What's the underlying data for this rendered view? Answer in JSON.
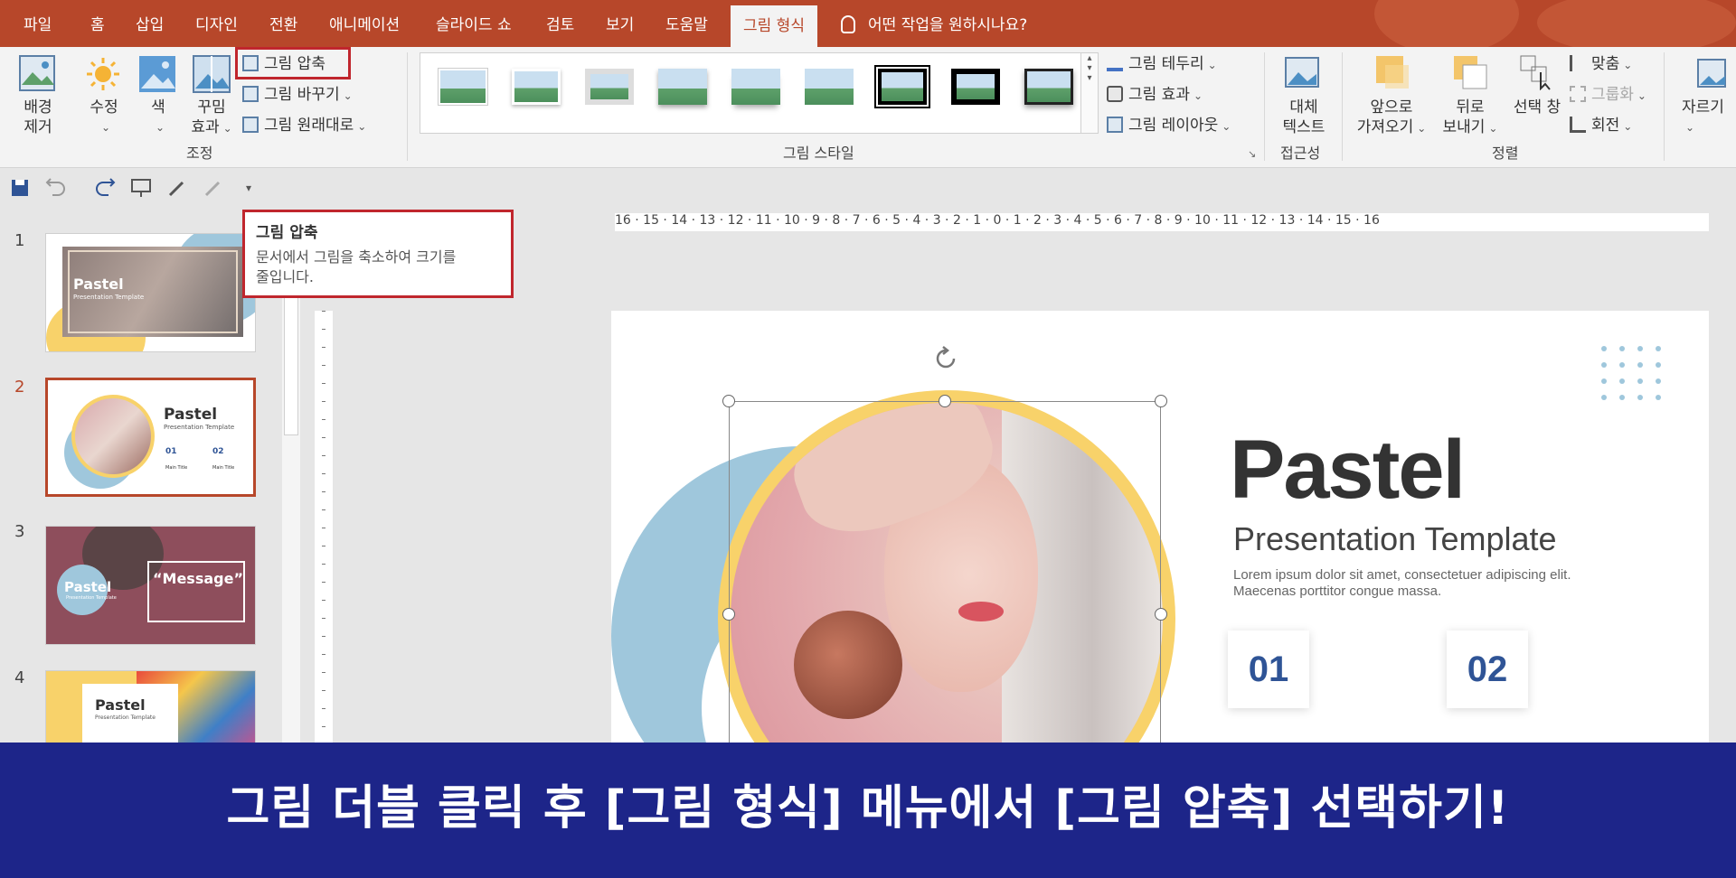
{
  "tabs": [
    "파일",
    "홈",
    "삽입",
    "디자인",
    "전환",
    "애니메이션",
    "슬라이드 쇼",
    "검토",
    "보기",
    "도움말",
    "그림 형식"
  ],
  "tell_me": "어떤 작업을 원하시나요?",
  "ribbon": {
    "remove_bg": [
      "배경",
      "제거"
    ],
    "corrections": "수정",
    "color": "색",
    "artistic": [
      "꾸밈",
      "효과"
    ],
    "compress": "그림 압축",
    "change": "그림 바꾸기",
    "reset": "그림 원래대로",
    "group_adjust": "조정",
    "border": "그림 테두리",
    "effects": "그림 효과",
    "layout": "그림 레이아웃",
    "group_styles": "그림 스타일",
    "alt_text": [
      "대체",
      "텍스트"
    ],
    "group_access": "접근성",
    "bring_forward": [
      "앞으로",
      "가져오기"
    ],
    "send_backward": [
      "뒤로",
      "보내기"
    ],
    "selection_pane": "선택 창",
    "align": "맞춤",
    "group": "그룹화",
    "rotate": "회전",
    "group_arrange": "정렬",
    "crop": "자르기"
  },
  "tooltip": {
    "title": "그림 압축",
    "desc_1": "문서에서 그림을 축소하여 크기를",
    "desc_2": "줄입니다."
  },
  "ruler_labels": "16 · 15 · 14 · 13 · 12 · 11 · 10 · 9 · 8 · 7 · 6 · 5 · 4 · 3 · 2 · 1 · 0 · 1 · 2 · 3 · 4 · 5 · 6 · 7 · 8 · 9 · 10 · 11 · 12 · 13 · 14 · 15 · 16",
  "slides": [
    {
      "num": "1",
      "title": "Pastel",
      "subtitle": "Presentation Template"
    },
    {
      "num": "2",
      "title": "Pastel",
      "subtitle": "Presentation Template",
      "n1": "01",
      "n2": "02",
      "m1": "Main Title",
      "m2": "Main Title"
    },
    {
      "num": "3",
      "title": "Pastel",
      "subtitle": "Presentation Template",
      "message": "“Message”"
    },
    {
      "num": "4",
      "title": "Pastel",
      "subtitle": "Presentation Template"
    }
  ],
  "main_slide": {
    "title": "Pastel",
    "subtitle": "Presentation Template",
    "body_1": "Lorem ipsum dolor sit amet, consectetuer adipiscing elit.",
    "body_2": "Maecenas porttitor congue massa.",
    "num1": "01",
    "num2": "02"
  },
  "banner": "그림 더블 클릭 후 [그림 형식] 메뉴에서 [그림 압축] 선택하기!",
  "colors": {
    "accent": "#b7472a",
    "highlight": "#c0262d",
    "banner": "#1d2589",
    "slide_blue": "#9fc7dc",
    "slide_yellow": "#f8d26a"
  }
}
